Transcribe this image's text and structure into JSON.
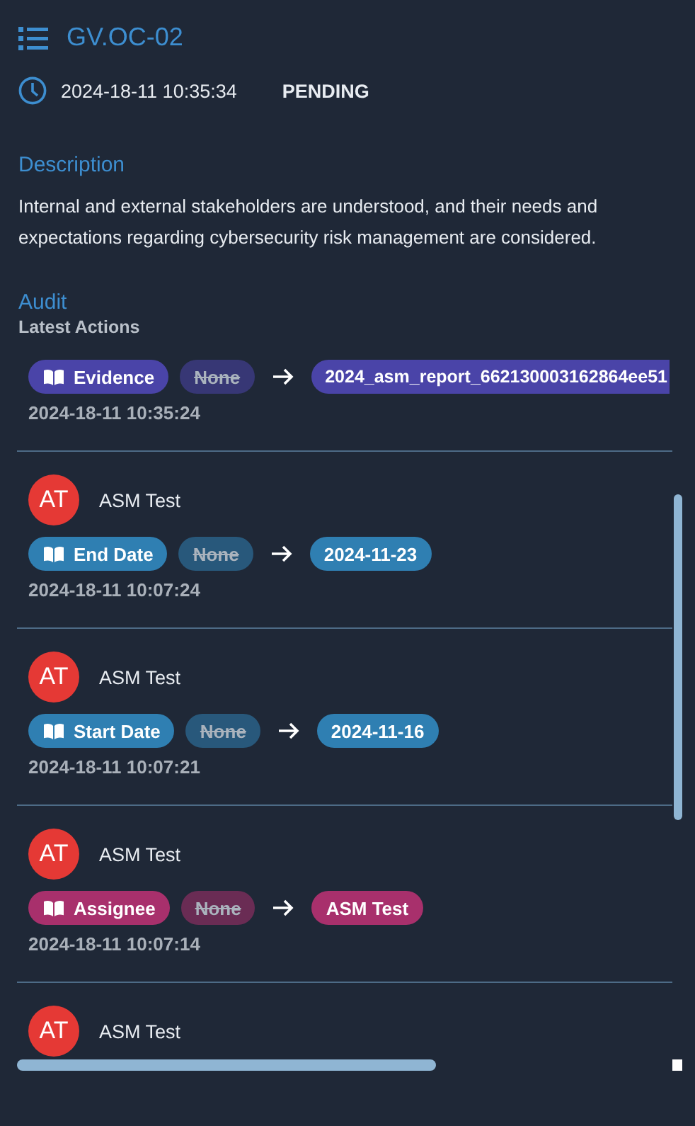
{
  "header": {
    "title": "GV.OC-02",
    "timestamp": "2024-18-11 10:35:34",
    "status": "PENDING"
  },
  "description": {
    "heading": "Description",
    "text": "Internal and external stakeholders are understood, and their needs and expectations regarding cybersecurity risk management are considered."
  },
  "audit": {
    "heading": "Audit",
    "subheading": "Latest Actions",
    "entries": [
      {
        "action": {
          "field": "Evidence",
          "old": "None",
          "new": "2024_asm_report_662130003162864ee51",
          "color": "#4a44a8"
        },
        "time": "2024-18-11 10:35:24"
      },
      {
        "user": {
          "initials": "AT",
          "name": "ASM Test"
        },
        "action": {
          "field": "End Date",
          "old": "None",
          "new": "2024-11-23",
          "color": "#2f7fb2"
        },
        "time": "2024-18-11 10:07:24"
      },
      {
        "user": {
          "initials": "AT",
          "name": "ASM Test"
        },
        "action": {
          "field": "Start Date",
          "old": "None",
          "new": "2024-11-16",
          "color": "#2f7fb2"
        },
        "time": "2024-18-11 10:07:21"
      },
      {
        "user": {
          "initials": "AT",
          "name": "ASM Test"
        },
        "action": {
          "field": "Assignee",
          "old": "None",
          "new": "ASM Test",
          "color": "#a8306c"
        },
        "time": "2024-18-11 10:07:14"
      },
      {
        "user": {
          "initials": "AT",
          "name": "ASM Test"
        }
      }
    ]
  }
}
